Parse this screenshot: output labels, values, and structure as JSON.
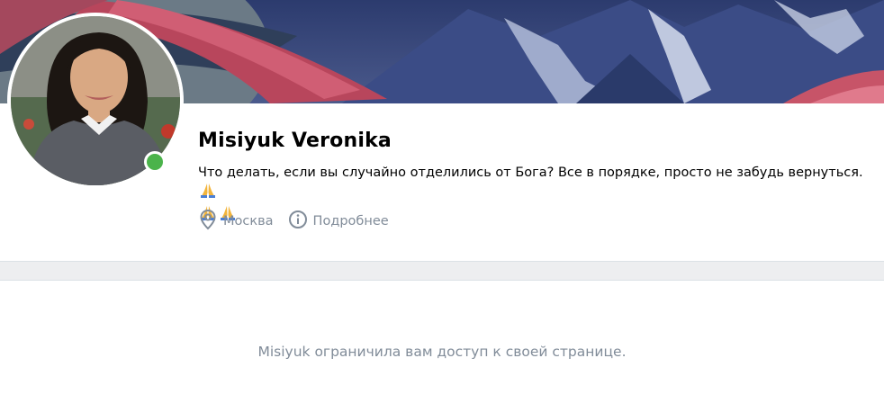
{
  "profile": {
    "name": "Misiyuk Veronika",
    "status_text": "Что делать, если вы случайно отделились от Бога? Все в порядке, просто не забудь вернуться.",
    "online": true,
    "location": "Москва",
    "more_label": "Подробнее"
  },
  "main": {
    "restricted_message": "Misiyuk ограничила вам доступ к своей странице."
  },
  "icons": {
    "emoji": "folded-hands",
    "location": "location-pin-icon",
    "info": "info-icon"
  },
  "colors": {
    "online": "#4bb34b",
    "secondary_text": "#818c99",
    "background": "#edeef0"
  }
}
